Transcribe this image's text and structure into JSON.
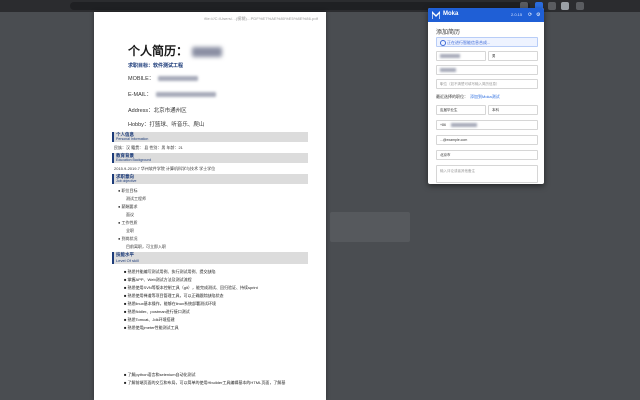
{
  "browser": {
    "url": ""
  },
  "document": {
    "url_text": "file:///C:/Users/...(模糊)...PDF%E7%AE%80%E5%8E%86.pdf",
    "title": "个人简历：",
    "objective": "求职目标：软件测试工程",
    "mobile_label": "MOBILE：",
    "email_label": "E-MAIL：",
    "address": "Address：北京市通州区",
    "hobby": "Hobby：打篮球、听音乐、爬山",
    "sections": {
      "personal": {
        "cn": "个人信息",
        "en": "Personal Information"
      },
      "education": {
        "cn": "教育背景",
        "en": "Education Background"
      },
      "objective": {
        "cn": "求职意向",
        "en": "Job objective"
      },
      "skills": {
        "cn": "技能水平",
        "en": "Level Of skill"
      }
    },
    "personal_line": "民族：汉          籍贯：    县            性别：男        年龄：21",
    "edu_line": "2015.9-2019.7       华州软件学院          计算机科学与技术          学士学位",
    "objective_items": [
      "职位目标",
      "测试工程师",
      "薪酬要求",
      "面议",
      "工作性质",
      "全职",
      "到岗状况",
      "目前离职，可立即入职"
    ],
    "skills": [
      "熟悉并能编写测试用例、执行测试用例、提交缺陷",
      "掌握APP、Web测试方法及测试流程",
      "熟悉使用SVN等版本控制工具（git），能完成测试、回归验证、持续sprint",
      "熟悉使用禅道等项目管理工具，可以正确跟踪缺陷状态",
      "熟悉linux基本操作，能够在linux系统部署测试环境",
      "熟悉fiddler、postman进行接口测试",
      "熟悉Tomcat、Jdk环境搭建",
      "熟悉使用jmeter性能测试工具"
    ],
    "bottom_lines": [
      "了解python语言和selenium自动化测试",
      "了解前端页面的交互和布局，可以简单的使用Hbuilder工具编辑基本的HTML页面，了解基"
    ]
  },
  "popup": {
    "app_name": "Moka",
    "version": "2.0.15",
    "title": "添加简历",
    "notice": "正在进行智能信息合成...",
    "gender_value": "男",
    "location_placeholder": "职位（如不清楚可填写输入简历信息）",
    "position_label": "最近选择的职位：",
    "position_link": "添加到Moka测试",
    "degree_value": "应届毕业生",
    "degree2_value": "本科",
    "phone_prefix": "+86",
    "email_value": "...@example.com",
    "city_value": "北京市",
    "notes_placeholder": "输入评论或者其他备注"
  },
  "colors": {
    "accent": "#1f5fd6",
    "section_blue": "#1d3c7a"
  }
}
